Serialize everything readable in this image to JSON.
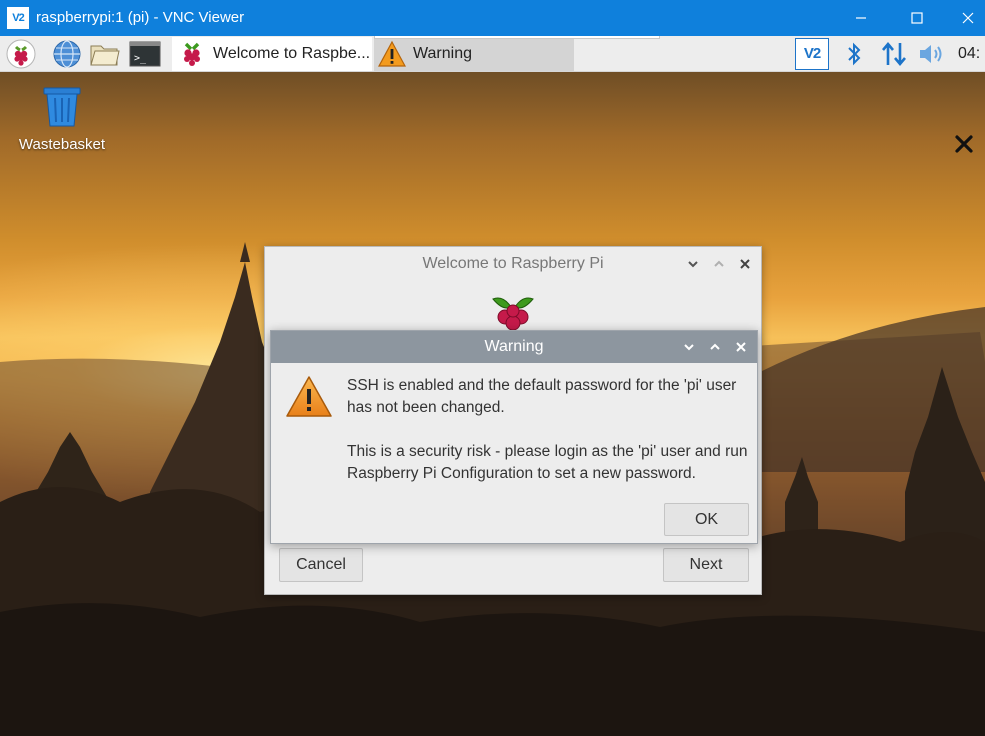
{
  "vnc_window": {
    "app_icon_text": "V2",
    "title": "raspberrypi:1 (pi) - VNC Viewer"
  },
  "taskbar": {
    "launchers": [
      "raspberry-menu",
      "web-browser",
      "file-manager",
      "terminal"
    ],
    "tasks": [
      {
        "label": "Welcome to Raspbe...",
        "icon": "raspberry",
        "state": "active"
      },
      {
        "label": "Warning",
        "icon": "warning",
        "state": "inactive"
      }
    ],
    "tray": {
      "vnc_icon_text": "V2",
      "clock": "04:"
    }
  },
  "desktop": {
    "icons": [
      {
        "label": "Wastebasket",
        "icon": "trash-bin"
      }
    ]
  },
  "welcome_dialog": {
    "title": "Welcome to Raspberry Pi",
    "cancel_label": "Cancel",
    "next_label": "Next"
  },
  "warning_dialog": {
    "title": "Warning",
    "message_lines_1": "SSH is enabled and the default password for the 'pi' user has not been changed.",
    "message_lines_2": "This is a security risk - please login as the 'pi' user and run Raspberry Pi Configuration to set a new password.",
    "ok_label": "OK"
  },
  "colors": {
    "vnc_titlebar": "#0f80dc",
    "warning_header": "#8d969f",
    "dialog_bg": "#ededed",
    "taskbar_bg": "#ededed"
  }
}
